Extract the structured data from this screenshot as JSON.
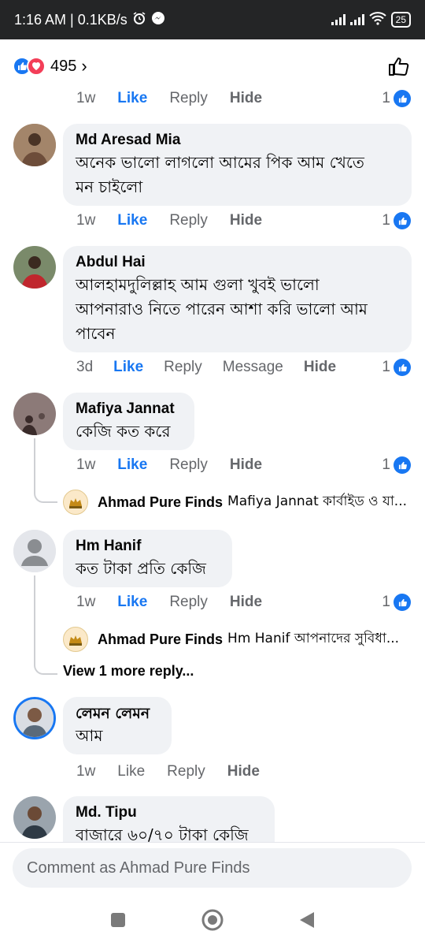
{
  "status_bar": {
    "time_speed": "1:16 AM | 0.1KB/s",
    "battery": "25"
  },
  "reactions": {
    "count": "495",
    "chevron": "›"
  },
  "comments": [
    {
      "name": "",
      "text": "",
      "time": "1w",
      "like": "Like",
      "reply": "Reply",
      "hide": "Hide",
      "reaction_count": "1"
    },
    {
      "name": "Md Aresad Mia",
      "text_lines": [
        "অনেক ভালো লাগলো আমের পিক আম খেতে",
        "মন চাইলো"
      ],
      "time": "1w",
      "like": "Like",
      "reply": "Reply",
      "hide": "Hide",
      "reaction_count": "1"
    },
    {
      "name": "Abdul Hai",
      "text_lines": [
        "আলহামদুলিল্লাহ আম গুলা খুবই ভালো",
        "আপনারাও নিতে পারেন আশা করি ভালো আম",
        "পাবেন"
      ],
      "time": "3d",
      "like": "Like",
      "reply": "Reply",
      "message": "Message",
      "hide": "Hide",
      "reaction_count": "1"
    },
    {
      "name": "Mafiya Jannat",
      "text_lines": [
        "কেজি কত করে"
      ],
      "time": "1w",
      "like": "Like",
      "reply": "Reply",
      "hide": "Hide",
      "reaction_count": "1",
      "reply_preview": {
        "name": "Ahmad Pure Finds",
        "text": "Mafiya Jannat কার্বাইড ও যা..."
      }
    },
    {
      "name": "Hm Hanif",
      "text_lines": [
        "কত টাকা প্রতি কেজি"
      ],
      "time": "1w",
      "like": "Like",
      "reply": "Reply",
      "hide": "Hide",
      "reaction_count": "1",
      "reply_preview": {
        "name": "Ahmad Pure Finds",
        "text": "Hm Hanif  আপনাদের সুবিধা..."
      },
      "view_more": "View 1 more reply..."
    },
    {
      "name": "লেমন লেমন",
      "text_lines": [
        "আম"
      ],
      "time": "1w",
      "like": "Like",
      "reply": "Reply",
      "hide": "Hide"
    },
    {
      "name": "Md. Tipu",
      "text_lines": [
        "বাজারে ৬০/৭০ টাকা কেজি"
      ]
    }
  ],
  "composer": {
    "placeholder": "Comment as Ahmad Pure Finds"
  },
  "colors": {
    "accent": "#1877f2",
    "bubble": "#f0f2f5",
    "muted_text": "#65676b",
    "status_bar": "#242526"
  }
}
